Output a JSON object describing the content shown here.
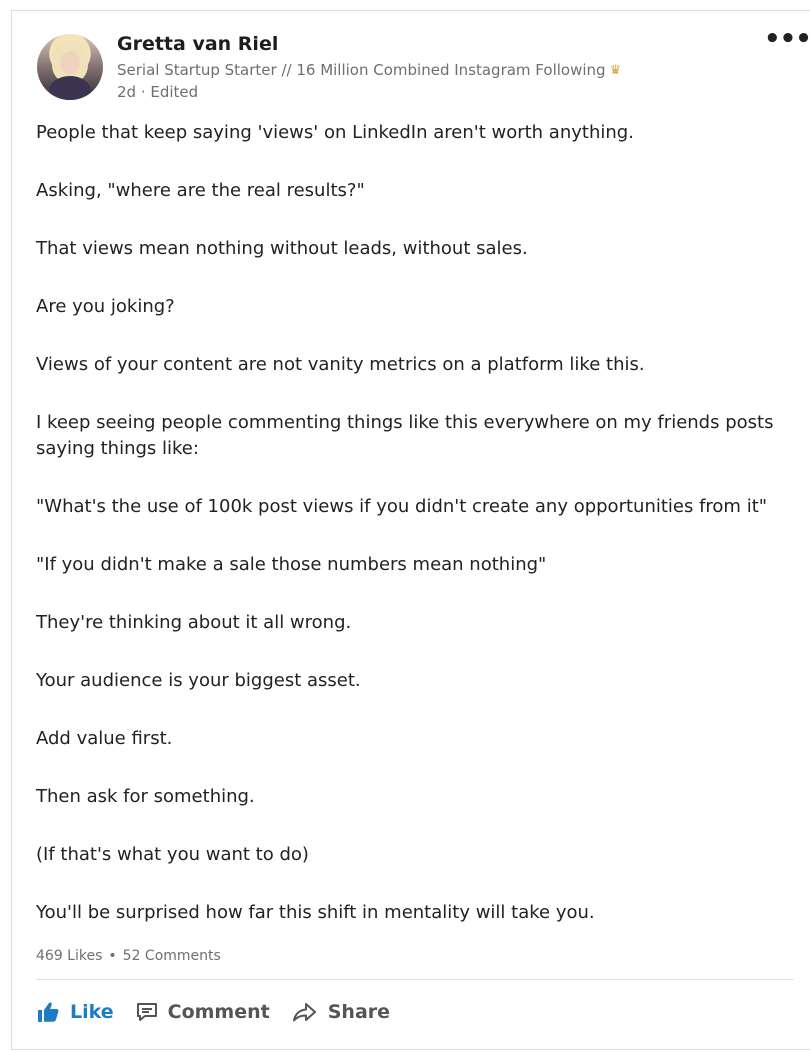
{
  "post": {
    "author": {
      "name": "Gretta van Riel",
      "headline": "Serial Startup Starter // 16 Million Combined Instagram Following",
      "time": "2d · Edited"
    },
    "paragraphs": [
      "People that keep saying 'views' on LinkedIn aren't worth anything.",
      "Asking, \"where are the real results?\"",
      "That views mean nothing without leads, without sales.",
      "Are you joking?",
      "Views of your content are not vanity metrics on a platform like this.",
      "I keep seeing people commenting things like this everywhere on my friends posts saying things like:",
      "\"What's the use of 100k post views if you didn't create any opportunities from it\"",
      "\"If you didn't make a sale those numbers mean nothing\"",
      "They're thinking about it all wrong.",
      "Your audience is your biggest asset.",
      "Add value first.",
      "Then ask for something.",
      "(If that's what you want to do)",
      "You'll be surprised how far this shift in mentality will take you."
    ],
    "stats": {
      "likes": "469 Likes",
      "separator": "•",
      "comments": "52 Comments"
    },
    "actions": {
      "like": "Like",
      "comment": "Comment",
      "share": "Share"
    },
    "more_menu": "•••"
  },
  "icons": {
    "headline_emoji": "crown-emoji-icon",
    "more": "more-options-icon",
    "like": "thumbs-up-icon",
    "comment": "comment-icon",
    "share": "share-arrow-icon"
  },
  "colors": {
    "like_accent": "#1c7cc4",
    "secondary_text": "#6f6f6f",
    "primary_text": "#222222"
  }
}
